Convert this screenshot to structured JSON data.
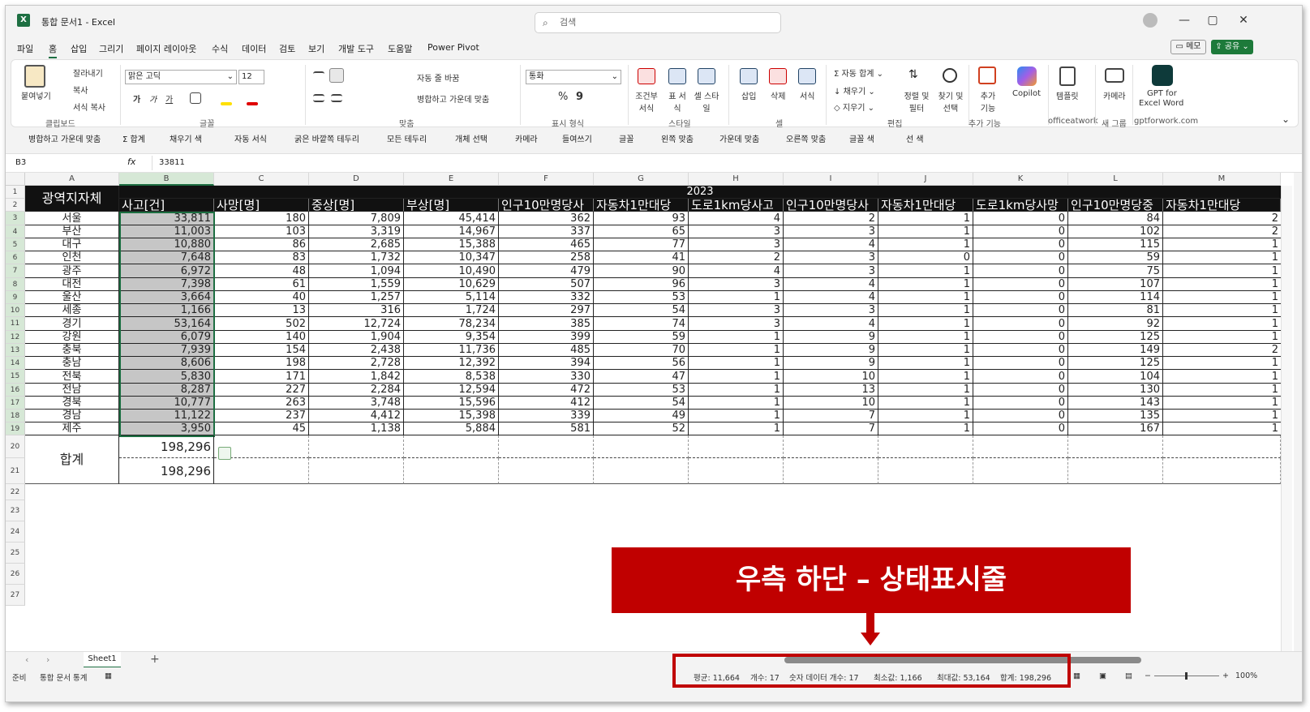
{
  "app": {
    "title": "통합 문서1 - Excel",
    "search_placeholder": "검색",
    "user_icon": "user-avatar-icon"
  },
  "menu": {
    "items": [
      "파일",
      "홈",
      "삽입",
      "그리기",
      "페이지 레이아웃",
      "수식",
      "데이터",
      "검토",
      "보기",
      "개발 도구",
      "도움말",
      "Power Pivot"
    ],
    "memo_label": "메모",
    "share_label": "공유"
  },
  "ribbon": {
    "clipboard": {
      "paste": "붙여넣기",
      "cut": "잘라내기",
      "copy": "복사",
      "format_painter": "서식 복사",
      "group": "클립보드"
    },
    "font": {
      "name": "맑은 고딕",
      "size": "12",
      "group": "글꼴"
    },
    "alignment": {
      "wrap": "자동 줄 바꿈",
      "merge": "병합하고 가운데 맞춤",
      "group": "맞춤"
    },
    "number": {
      "format": "통화",
      "group": "표시 형식"
    },
    "styles": {
      "conditional": "조건부 서식",
      "table": "표 서식",
      "cell": "셀 스타일",
      "group": "스타일"
    },
    "cells": {
      "insert": "삽입",
      "delete": "삭제",
      "format": "서식",
      "group": "셀"
    },
    "editing": {
      "autosum": "자동 합계",
      "fill": "채우기",
      "clear": "지우기",
      "sort": "정렬 및 필터",
      "find": "찾기 및 선택",
      "group": "편집"
    },
    "addins": {
      "addin": "추가 기능",
      "group": "추가 기능"
    },
    "copilot": "Copilot",
    "template": {
      "label": "템플릿",
      "group": "officeatwork"
    },
    "camera": {
      "label": "카메라",
      "group": "새 그룹"
    },
    "gpt": {
      "label1": "GPT for",
      "label2": "Excel Word",
      "group": "gptforwork.com"
    }
  },
  "qat": {
    "items": [
      "병합하고 가운데 맞춤",
      "합계",
      "채우기 색",
      "자동 서식",
      "굵은 바깥쪽 테두리",
      "모든 테두리",
      "개체 선택",
      "카메라",
      "들여쓰기",
      "글꼴",
      "왼쪽 맞춤",
      "가운데 맞춤",
      "오른쪽 맞춤",
      "글꼴 색",
      "선 색"
    ]
  },
  "formula": {
    "name_box": "B3",
    "fx": "fx",
    "value": "33811"
  },
  "sheet": {
    "columns": [
      "A",
      "B",
      "C",
      "D",
      "E",
      "F",
      "G",
      "H",
      "I",
      "J",
      "K",
      "L",
      "M"
    ],
    "rows": [
      "1",
      "2",
      "3",
      "4",
      "5",
      "6",
      "7",
      "8",
      "9",
      "10",
      "11",
      "12",
      "13",
      "14",
      "15",
      "16",
      "17",
      "18",
      "19",
      "20",
      "21",
      "22",
      "23",
      "24",
      "25",
      "26",
      "27"
    ],
    "year_header": "2023",
    "region_header": "광역지자체",
    "headers": [
      "사고[건]",
      "사망[명]",
      "중상[명]",
      "부상[명]",
      "인구10만명당사",
      "자동차1만대당",
      "도로1km당사고",
      "인구10만명당사",
      "자동차1만대당",
      "도로1km당사망",
      "인구10만명당중",
      "자동차1만대당"
    ],
    "data": [
      [
        "서울",
        "33,811",
        "180",
        "7,809",
        "45,414",
        "362",
        "93",
        "4",
        "2",
        "1",
        "0",
        "84",
        "2"
      ],
      [
        "부산",
        "11,003",
        "103",
        "3,319",
        "14,967",
        "337",
        "65",
        "3",
        "3",
        "1",
        "0",
        "102",
        "2"
      ],
      [
        "대구",
        "10,880",
        "86",
        "2,685",
        "15,388",
        "465",
        "77",
        "3",
        "4",
        "1",
        "0",
        "115",
        "1"
      ],
      [
        "인천",
        "7,648",
        "83",
        "1,732",
        "10,347",
        "258",
        "41",
        "2",
        "3",
        "0",
        "0",
        "59",
        "1"
      ],
      [
        "광주",
        "6,972",
        "48",
        "1,094",
        "10,490",
        "479",
        "90",
        "4",
        "3",
        "1",
        "0",
        "75",
        "1"
      ],
      [
        "대전",
        "7,398",
        "61",
        "1,559",
        "10,629",
        "507",
        "96",
        "3",
        "4",
        "1",
        "0",
        "107",
        "1"
      ],
      [
        "울산",
        "3,664",
        "40",
        "1,257",
        "5,114",
        "332",
        "53",
        "1",
        "4",
        "1",
        "0",
        "114",
        "1"
      ],
      [
        "세종",
        "1,166",
        "13",
        "316",
        "1,724",
        "297",
        "54",
        "3",
        "3",
        "1",
        "0",
        "81",
        "1"
      ],
      [
        "경기",
        "53,164",
        "502",
        "12,724",
        "78,234",
        "385",
        "74",
        "3",
        "4",
        "1",
        "0",
        "92",
        "1"
      ],
      [
        "강원",
        "6,079",
        "140",
        "1,904",
        "9,354",
        "399",
        "59",
        "1",
        "9",
        "1",
        "0",
        "125",
        "1"
      ],
      [
        "충북",
        "7,939",
        "154",
        "2,438",
        "11,736",
        "485",
        "70",
        "1",
        "9",
        "1",
        "0",
        "149",
        "2"
      ],
      [
        "충남",
        "8,606",
        "198",
        "2,728",
        "12,392",
        "394",
        "56",
        "1",
        "9",
        "1",
        "0",
        "125",
        "1"
      ],
      [
        "전북",
        "5,830",
        "171",
        "1,842",
        "8,538",
        "330",
        "47",
        "1",
        "10",
        "1",
        "0",
        "104",
        "1"
      ],
      [
        "전남",
        "8,287",
        "227",
        "2,284",
        "12,594",
        "472",
        "53",
        "1",
        "13",
        "1",
        "0",
        "130",
        "1"
      ],
      [
        "경북",
        "10,777",
        "263",
        "3,748",
        "15,596",
        "412",
        "54",
        "1",
        "10",
        "1",
        "0",
        "143",
        "1"
      ],
      [
        "경남",
        "11,122",
        "237",
        "4,412",
        "15,398",
        "339",
        "49",
        "1",
        "7",
        "1",
        "0",
        "135",
        "1"
      ],
      [
        "제주",
        "3,950",
        "45",
        "1,138",
        "5,884",
        "581",
        "52",
        "1",
        "7",
        "1",
        "0",
        "167",
        "1"
      ]
    ],
    "total_label": "합계",
    "total1": "198,296",
    "total2": "198,296",
    "tab_name": "Sheet1"
  },
  "status": {
    "ready": "준비",
    "stats_label": "통합 문서 통계",
    "avg": "평균: 11,664",
    "count": "개수: 17",
    "numcount": "숫자 데이터 개수: 17",
    "min": "최소값: 1,166",
    "max": "최대값: 53,164",
    "sum": "합계: 198,296",
    "zoom": "100%"
  },
  "callout": {
    "text": "우측 하단 – 상태표시줄",
    "color": "#c00000"
  }
}
